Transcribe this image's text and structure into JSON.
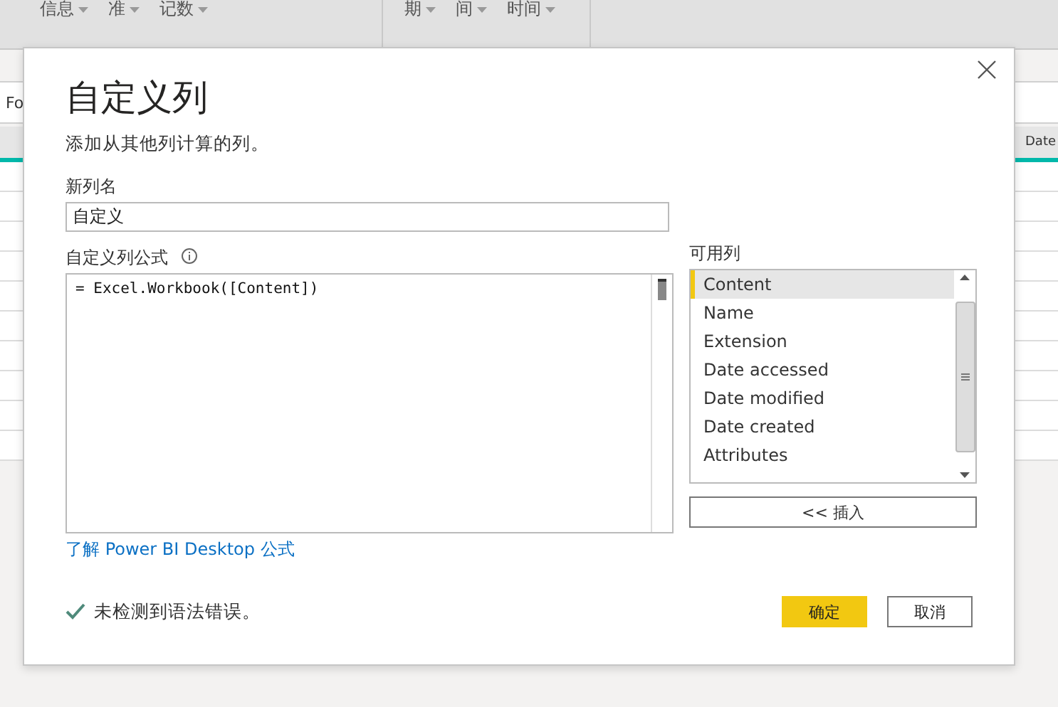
{
  "ribbon": {
    "groups": [
      {
        "items": [
          {
            "label": "信息"
          },
          {
            "label": "准"
          },
          {
            "label": "记数"
          }
        ]
      },
      {
        "items": [
          {
            "label": "期"
          },
          {
            "label": "间"
          },
          {
            "label": "时间"
          }
        ]
      }
    ]
  },
  "workspace": {
    "formula_bar": "Fo",
    "column_header": "Date"
  },
  "dialog": {
    "title": "自定义列",
    "subtitle": "添加从其他列计算的列。",
    "name_label": "新列名",
    "name_value": "自定义",
    "formula_label": "自定义列公式",
    "formula": "= Excel.Workbook([Content])",
    "columns_label": "可用列",
    "columns": [
      {
        "label": "Content",
        "selected": true
      },
      {
        "label": "Name",
        "selected": false
      },
      {
        "label": "Extension",
        "selected": false
      },
      {
        "label": "Date accessed",
        "selected": false
      },
      {
        "label": "Date modified",
        "selected": false
      },
      {
        "label": "Date created",
        "selected": false
      },
      {
        "label": "Attributes",
        "selected": false
      }
    ],
    "insert_button": "<< 插入",
    "link": "了解 Power BI Desktop 公式",
    "status": "未检测到语法错误。",
    "ok_button": "确定",
    "cancel_button": "取消"
  }
}
